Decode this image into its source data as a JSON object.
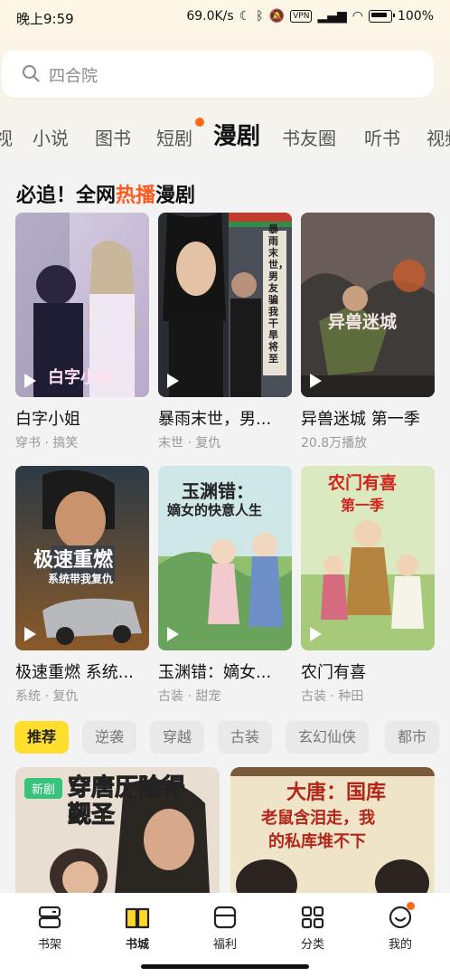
{
  "status": {
    "time": "晚上9:59",
    "speed": "69.0K/s",
    "vpn": "VPN",
    "battery": "100%"
  },
  "search": {
    "placeholder": "四合院"
  },
  "tabs": [
    "视",
    "小说",
    "图书",
    "短剧",
    "漫剧",
    "书友圈",
    "听书",
    "视频"
  ],
  "active_tab": "漫剧",
  "section": {
    "title_pre": "必追！全网",
    "title_hl": "热播",
    "title_post": "漫剧"
  },
  "dramas": [
    {
      "title": "白字小姐",
      "sub": "穿书 · 搞笑",
      "cover_text": "白字小姐"
    },
    {
      "title": "暴雨末世，男...",
      "sub": "末世 · 复仇",
      "cover_text": "暴雨末世，男友骗我干旱将至"
    },
    {
      "title": "异兽迷城 第一季",
      "sub": "20.8万播放",
      "cover_text": "异兽迷城"
    },
    {
      "title": "极速重燃 系统...",
      "sub": "系统 · 复仇",
      "cover_text": "极速重燃",
      "cover_sub": "系统带我复仇"
    },
    {
      "title": "玉渊错：嫡女...",
      "sub": "古装 · 甜宠",
      "cover_text": "玉渊错：",
      "cover_sub": "嫡女的快意人生"
    },
    {
      "title": "农门有喜",
      "sub": "古装 · 种田",
      "cover_text": "农门有喜",
      "cover_sub": "第一季"
    }
  ],
  "chips": [
    "推荐",
    "逆袭",
    "穿越",
    "古装",
    "玄幻仙侠",
    "都市"
  ],
  "feed": [
    {
      "badge": "新剧",
      "cover_text": "穿唐历险得觐圣"
    },
    {
      "cover_text": "大唐：国库",
      "cover_sub1": "老鼠含泪走，我",
      "cover_sub2": "的私库堆不下"
    }
  ],
  "nav": [
    {
      "label": "书架",
      "icon": "bookshelf-icon"
    },
    {
      "label": "书城",
      "icon": "open-book-icon"
    },
    {
      "label": "福利",
      "icon": "gift-box-icon"
    },
    {
      "label": "分类",
      "icon": "grid-icon"
    },
    {
      "label": "我的",
      "icon": "smile-face-icon"
    }
  ],
  "colors": {
    "accent_yellow": "#ffd82a",
    "hot_orange": "#ff5a1e",
    "badge_green": "#38c37c"
  }
}
